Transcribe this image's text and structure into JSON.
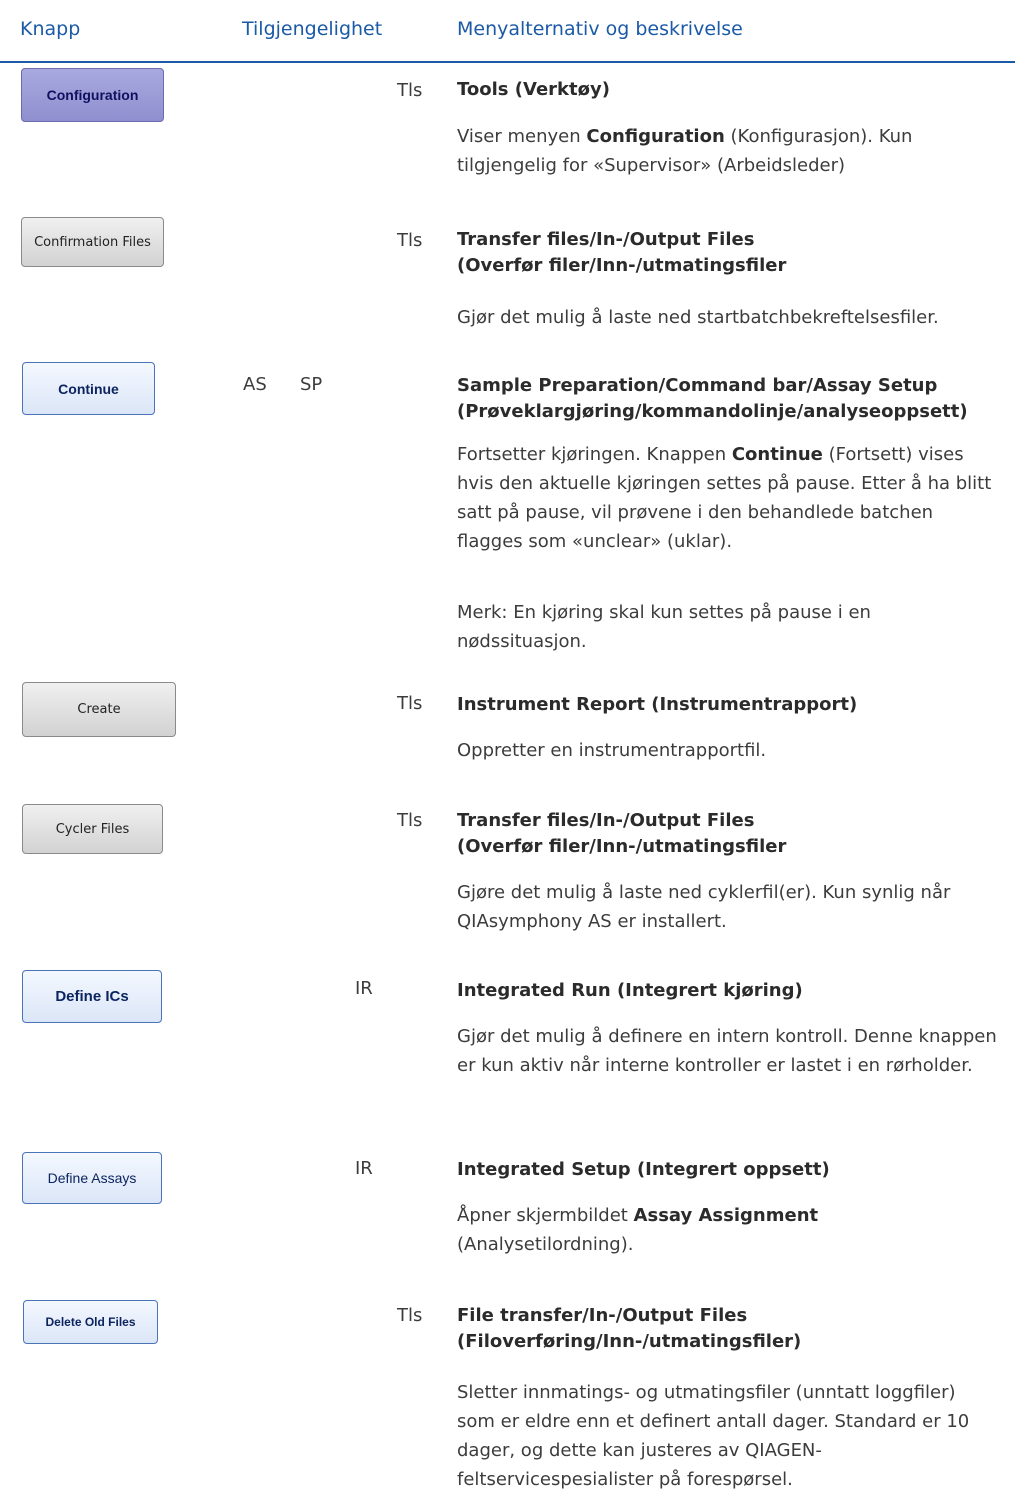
{
  "header": {
    "col_button": "Knapp",
    "col_availability": "Tilgjengelighet",
    "col_menu": "Menyalternativ og beskrivelse"
  },
  "rows": [
    {
      "button": "Configuration",
      "availability": "Tls",
      "title1": "Tools (Verktøy)",
      "desc1": [
        {
          "t": "Viser menyen "
        },
        {
          "b": "Configuration"
        },
        {
          "t": " (Konfigurasjon). Kun tilgjengelig for «Supervisor» (Arbeidsleder)"
        }
      ]
    },
    {
      "button": "Confirmation Files",
      "availability": "Tls",
      "title1": "Transfer files/In-/Output Files",
      "title2": "(Overfør filer/Inn-/utmatingsfiler",
      "desc1": [
        {
          "t": "Gjør det mulig å laste ned startbatchbekreftelsesfiler."
        }
      ]
    },
    {
      "button": "Continue",
      "availability_a": "AS",
      "availability_b": "SP",
      "title1": "Sample Preparation/Command bar/Assay Setup",
      "title2": "(Prøveklargjøring/kommandolinje/analyseoppsett)",
      "desc1": [
        {
          "t": "Fortsetter kjøringen. Knappen "
        },
        {
          "b": "Continue"
        },
        {
          "t": " (Fortsett) vises hvis den aktuelle kjøringen settes på pause. Etter å ha blitt satt på pause, vil prøvene i den behandlede batchen flagges som «unclear» (uklar)."
        }
      ],
      "desc2": [
        {
          "t": "Merk: En kjøring skal kun settes på pause i en nødssituasjon."
        }
      ]
    },
    {
      "button": "Create",
      "availability": "Tls",
      "title1": "Instrument Report (Instrumentrapport)",
      "desc1": [
        {
          "t": "Oppretter en instrumentrapportfil."
        }
      ]
    },
    {
      "button": "Cycler Files",
      "availability": "Tls",
      "title1": "Transfer files/In-/Output Files",
      "title2": "(Overfør filer/Inn-/utmatingsfiler",
      "desc1": [
        {
          "t": "Gjøre det mulig å laste ned cyklerfil(er). Kun synlig når QIAsymphony AS er installert."
        }
      ]
    },
    {
      "button": "Define ICs",
      "availability": "IR",
      "title1": "Integrated Run (Integrert kjøring)",
      "desc1": [
        {
          "t": "Gjør det mulig å definere en intern kontroll. Denne knappen er kun aktiv når interne kontroller er lastet i en rørholder."
        }
      ]
    },
    {
      "button": "Define Assays",
      "availability": "IR",
      "title1": "Integrated Setup (Integrert oppsett)",
      "desc1": [
        {
          "t": "Åpner skjermbildet "
        },
        {
          "b": "Assay Assignment"
        },
        {
          "t": " (Analysetilordning)."
        }
      ]
    },
    {
      "button": "Delete Old Files",
      "availability": "Tls",
      "title1": "File transfer/In-/Output Files",
      "title2": "(Filoverføring/Inn-/utmatingsfiler)",
      "desc1": [
        {
          "t": "Sletter innmatings- og utmatingsfiler (unntatt loggfiler) som er eldre enn et definert antall dager. Standard er 10 dager, og dette kan justeres av QIAGEN-feltservicespesialister på forespørsel."
        }
      ]
    }
  ]
}
